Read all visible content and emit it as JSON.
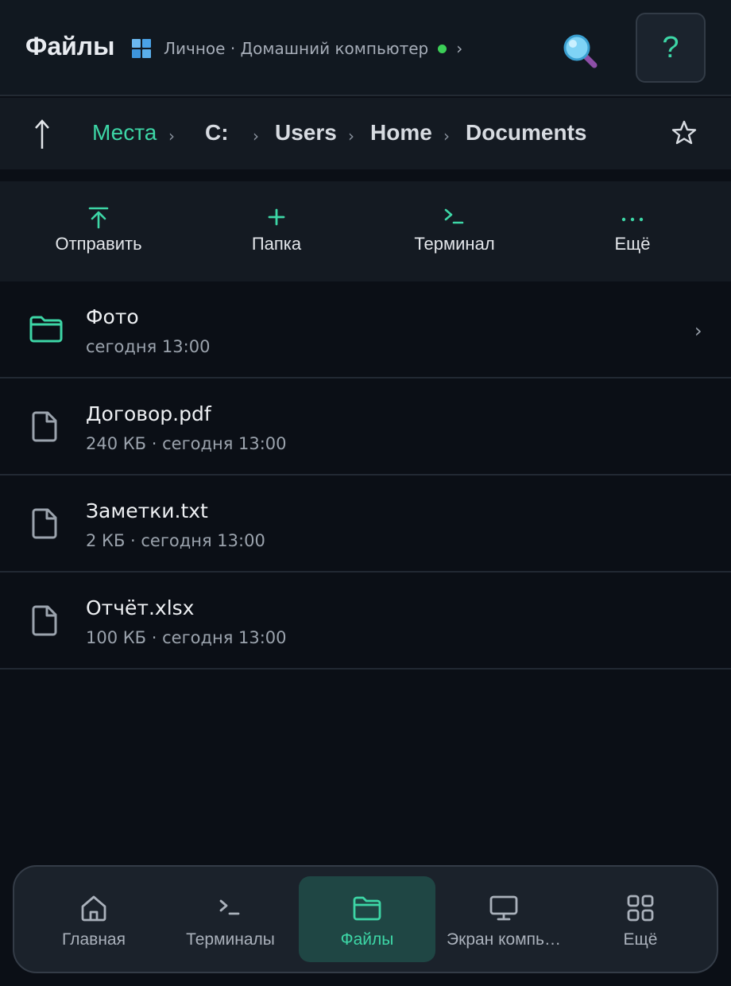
{
  "header": {
    "title": "Файлы",
    "device_label": "Личное · Домашний компьютер",
    "device_chevron": "›",
    "help_label": "?"
  },
  "breadcrumb": {
    "items": [
      "Места",
      "C:",
      "Users",
      "Home",
      "Documents"
    ],
    "separator": "›"
  },
  "toolbar": {
    "items": [
      {
        "label": "Отправить",
        "icon": "upload-icon"
      },
      {
        "label": "Папка",
        "icon": "plus-icon"
      },
      {
        "label": "Терминал",
        "icon": "terminal-icon"
      },
      {
        "label": "Ещё",
        "icon": "more-dots-icon"
      }
    ]
  },
  "files": [
    {
      "name": "Фото",
      "meta": "сегодня 13:00",
      "type": "folder",
      "chevron": "›"
    },
    {
      "name": "Договор.pdf",
      "meta": "240 КБ · сегодня 13:00",
      "type": "file"
    },
    {
      "name": "Заметки.txt",
      "meta": "2 КБ · сегодня 13:00",
      "type": "file"
    },
    {
      "name": "Отчёт.xlsx",
      "meta": "100 КБ · сегодня 13:00",
      "type": "file"
    }
  ],
  "bottom_nav": {
    "items": [
      {
        "label": "Главная",
        "icon": "home-icon"
      },
      {
        "label": "Терминалы",
        "icon": "terminal-icon"
      },
      {
        "label": "Файлы",
        "icon": "folder-icon",
        "active": true
      },
      {
        "label": "Экран компь…",
        "icon": "monitor-icon"
      },
      {
        "label": "Ещё",
        "icon": "grid-icon"
      }
    ]
  },
  "colors": {
    "accent": "#3dd6a6",
    "background": "#0b0f16",
    "online": "#3ccf57"
  }
}
